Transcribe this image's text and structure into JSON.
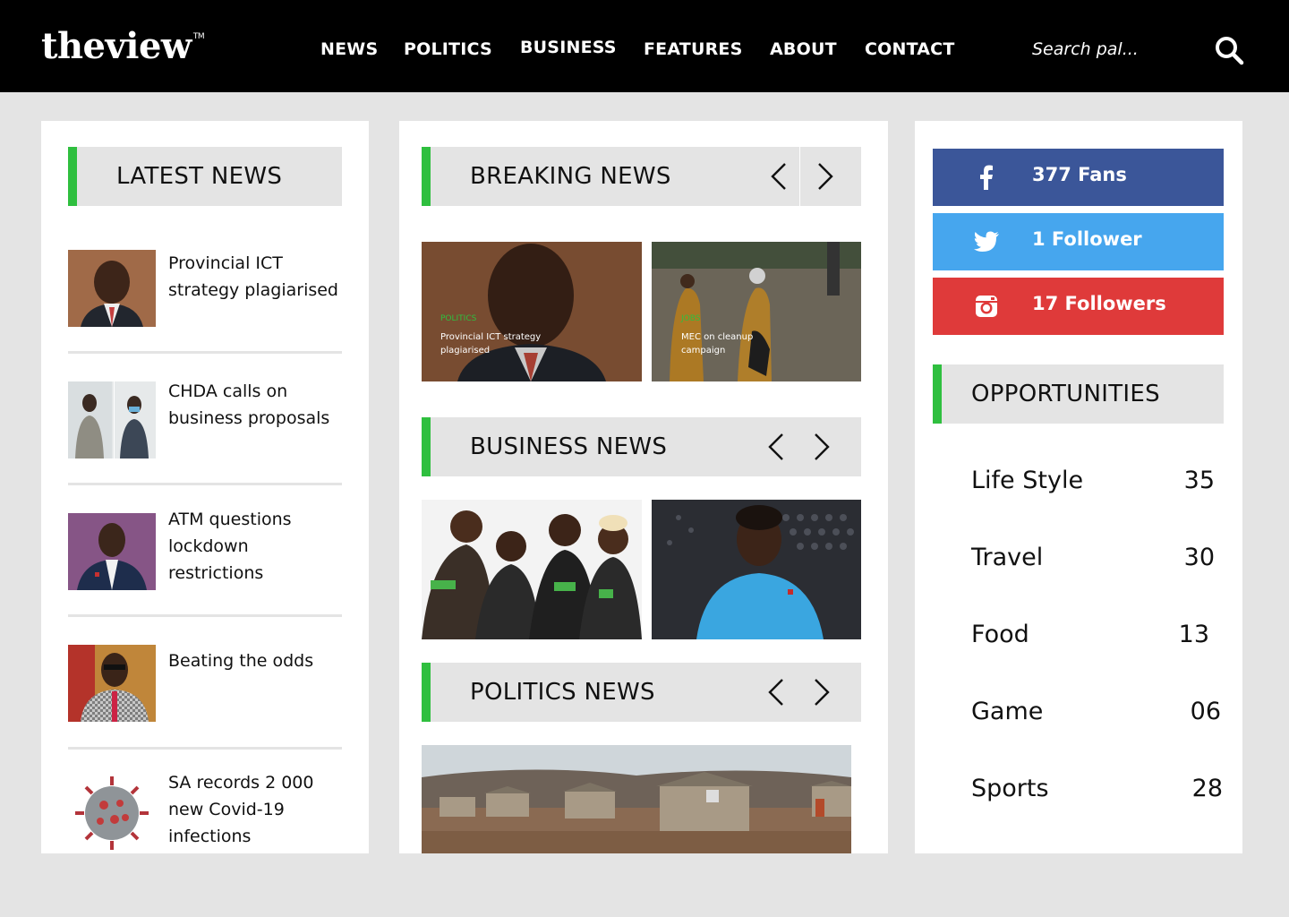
{
  "header": {
    "logo": "theview",
    "logo_tm": "TM",
    "nav": [
      "NEWS",
      "POLITICS",
      "BUSINESS",
      "FEATURES",
      "ABOUT",
      "CONTACT"
    ],
    "search_placeholder": "Search pal..."
  },
  "latest": {
    "title": "LATEST NEWS",
    "items": [
      {
        "title": " Provincial ICT strategy plagiarised"
      },
      {
        "title": "CHDA calls on business proposals"
      },
      {
        "title": "ATM questions lockdown restrictions"
      },
      {
        "title": "Beating the odds"
      },
      {
        "title": "SA records 2 000 new Covid-19 infections"
      }
    ]
  },
  "breaking": {
    "title": "BREAKING NEWS",
    "cards": [
      {
        "category": "POLITICS",
        "caption_line1": "Provincial ICT strategy",
        "caption_line2": "plagiarised"
      },
      {
        "category": "JOBS",
        "caption_line1": "MEC on cleanup",
        "caption_line2": "campaign"
      }
    ]
  },
  "business": {
    "title": "BUSINESS NEWS"
  },
  "politics": {
    "title": "POLITICS NEWS"
  },
  "social": {
    "facebook": {
      "label": "377 Fans",
      "color": "#3b5699"
    },
    "twitter": {
      "label": "1 Follower",
      "color": "#46a6ee"
    },
    "instagram": {
      "label": "17 Followers",
      "color": "#df3a3a"
    }
  },
  "opportunities": {
    "title": "OPPORTUNITIES",
    "items": [
      {
        "name": "Life Style",
        "count": "35"
      },
      {
        "name": "Travel",
        "count": "30"
      },
      {
        "name": "Food",
        "count": "13"
      },
      {
        "name": "Game",
        "count": "06"
      },
      {
        "name": "Sports",
        "count": "28"
      }
    ]
  },
  "colors": {
    "accent": "#2fbf3f",
    "header_bg": "#000000",
    "page_bg": "#e4e4e4"
  }
}
